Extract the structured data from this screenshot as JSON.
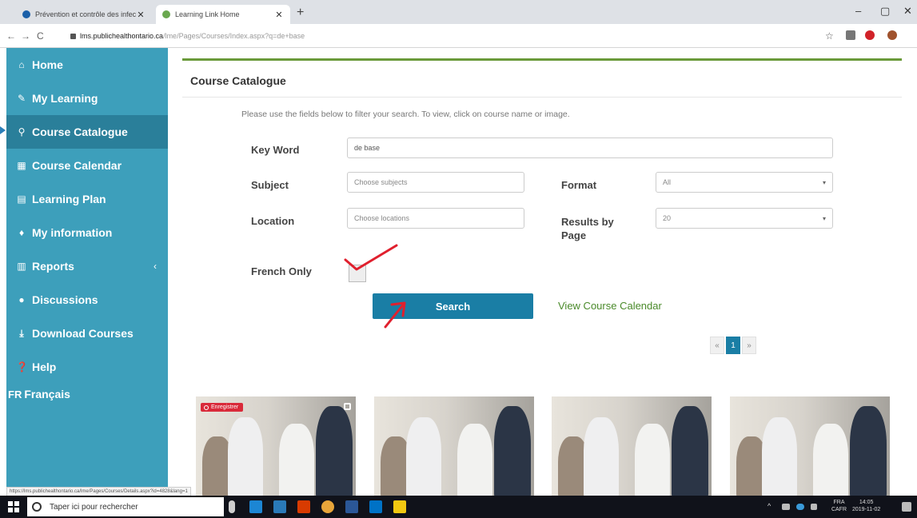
{
  "browser": {
    "tabs": [
      {
        "title": "Prévention et contrôle des infect",
        "active": false,
        "favicon_color": "#1a5fa8"
      },
      {
        "title": "Learning Link Home",
        "active": true,
        "favicon_color": "#6aa84f"
      }
    ],
    "new_tab": "+",
    "close_glyph": "✕",
    "window_controls": {
      "minimize": "–",
      "maximize": "▢",
      "close": "✕"
    },
    "nav": {
      "back": "←",
      "forward": "→",
      "reload": "C"
    },
    "url_host": "lms.publichealthontario.ca",
    "url_path": "/lme/Pages/Courses/Index.aspx?q=de+base",
    "star": "☆",
    "extensions": [
      {
        "name": "cast-icon",
        "color": "#777777"
      },
      {
        "name": "pinterest-icon",
        "color": "#d12229"
      },
      {
        "name": "profile-icon",
        "color": "#a0522d"
      }
    ]
  },
  "sidebar": {
    "active_item": "Course Catalogue",
    "items": [
      {
        "label": "Home",
        "icon": "⌂"
      },
      {
        "label": "My Learning",
        "icon": "✎"
      },
      {
        "label": "Course Catalogue",
        "icon": "⚲"
      },
      {
        "label": "Course Calendar",
        "icon": "▦"
      },
      {
        "label": "Learning Plan",
        "icon": "▤"
      },
      {
        "label": "My information",
        "icon": "♦"
      },
      {
        "label": "Reports",
        "icon": "▥"
      },
      {
        "label": "Discussions",
        "icon": "●"
      },
      {
        "label": "Download Courses",
        "icon": "⤓"
      },
      {
        "label": "Help",
        "icon": "❓"
      },
      {
        "label": "Français",
        "icon": "FR"
      }
    ],
    "reports_chevron": "‹"
  },
  "main": {
    "title": "Course Catalogue",
    "instructions": "Please use the fields below to filter your search. To view, click on course name or image.",
    "form": {
      "keyword_label": "Key Word",
      "keyword_value": "de base",
      "subject_label": "Subject",
      "subject_placeholder": "Choose subjects",
      "location_label": "Location",
      "location_placeholder": "Choose locations",
      "format_label": "Format",
      "format_value": "All",
      "results_label": "Results by Page",
      "results_value": "20",
      "french_label": "French Only",
      "select_caret": "▾"
    },
    "search_button": "Search",
    "calendar_link": "View Course Calendar",
    "pagination": {
      "prev": "«",
      "current": "1",
      "next": "»"
    },
    "cards": [
      {
        "badge": "Enregistrer"
      },
      {},
      {},
      {}
    ],
    "annotation_color": "#e0202e",
    "accent": "#1a7ea5",
    "sidebar_color": "#3d9fbb"
  },
  "status_url": "https://lms.publichealthontario.ca/lme/Pages/Courses/Details.aspx?id=4828&lang=1",
  "taskbar": {
    "search_placeholder": "Taper ici pour rechercher",
    "lang_line1": "FRA",
    "lang_line2": "CAFR",
    "time": "14:05",
    "date": "2019-11-02",
    "apps": [
      {
        "name": "edge-icon",
        "color": "#1c86d4"
      },
      {
        "name": "store-icon",
        "color": "#2a7ab8"
      },
      {
        "name": "office-icon",
        "color": "#d83b01"
      },
      {
        "name": "chrome-icon",
        "color": "#e8a53a"
      },
      {
        "name": "word-icon",
        "color": "#2b5797"
      },
      {
        "name": "outlook-icon",
        "color": "#0072c6"
      },
      {
        "name": "sticky-notes-icon",
        "color": "#f2c811"
      }
    ]
  }
}
